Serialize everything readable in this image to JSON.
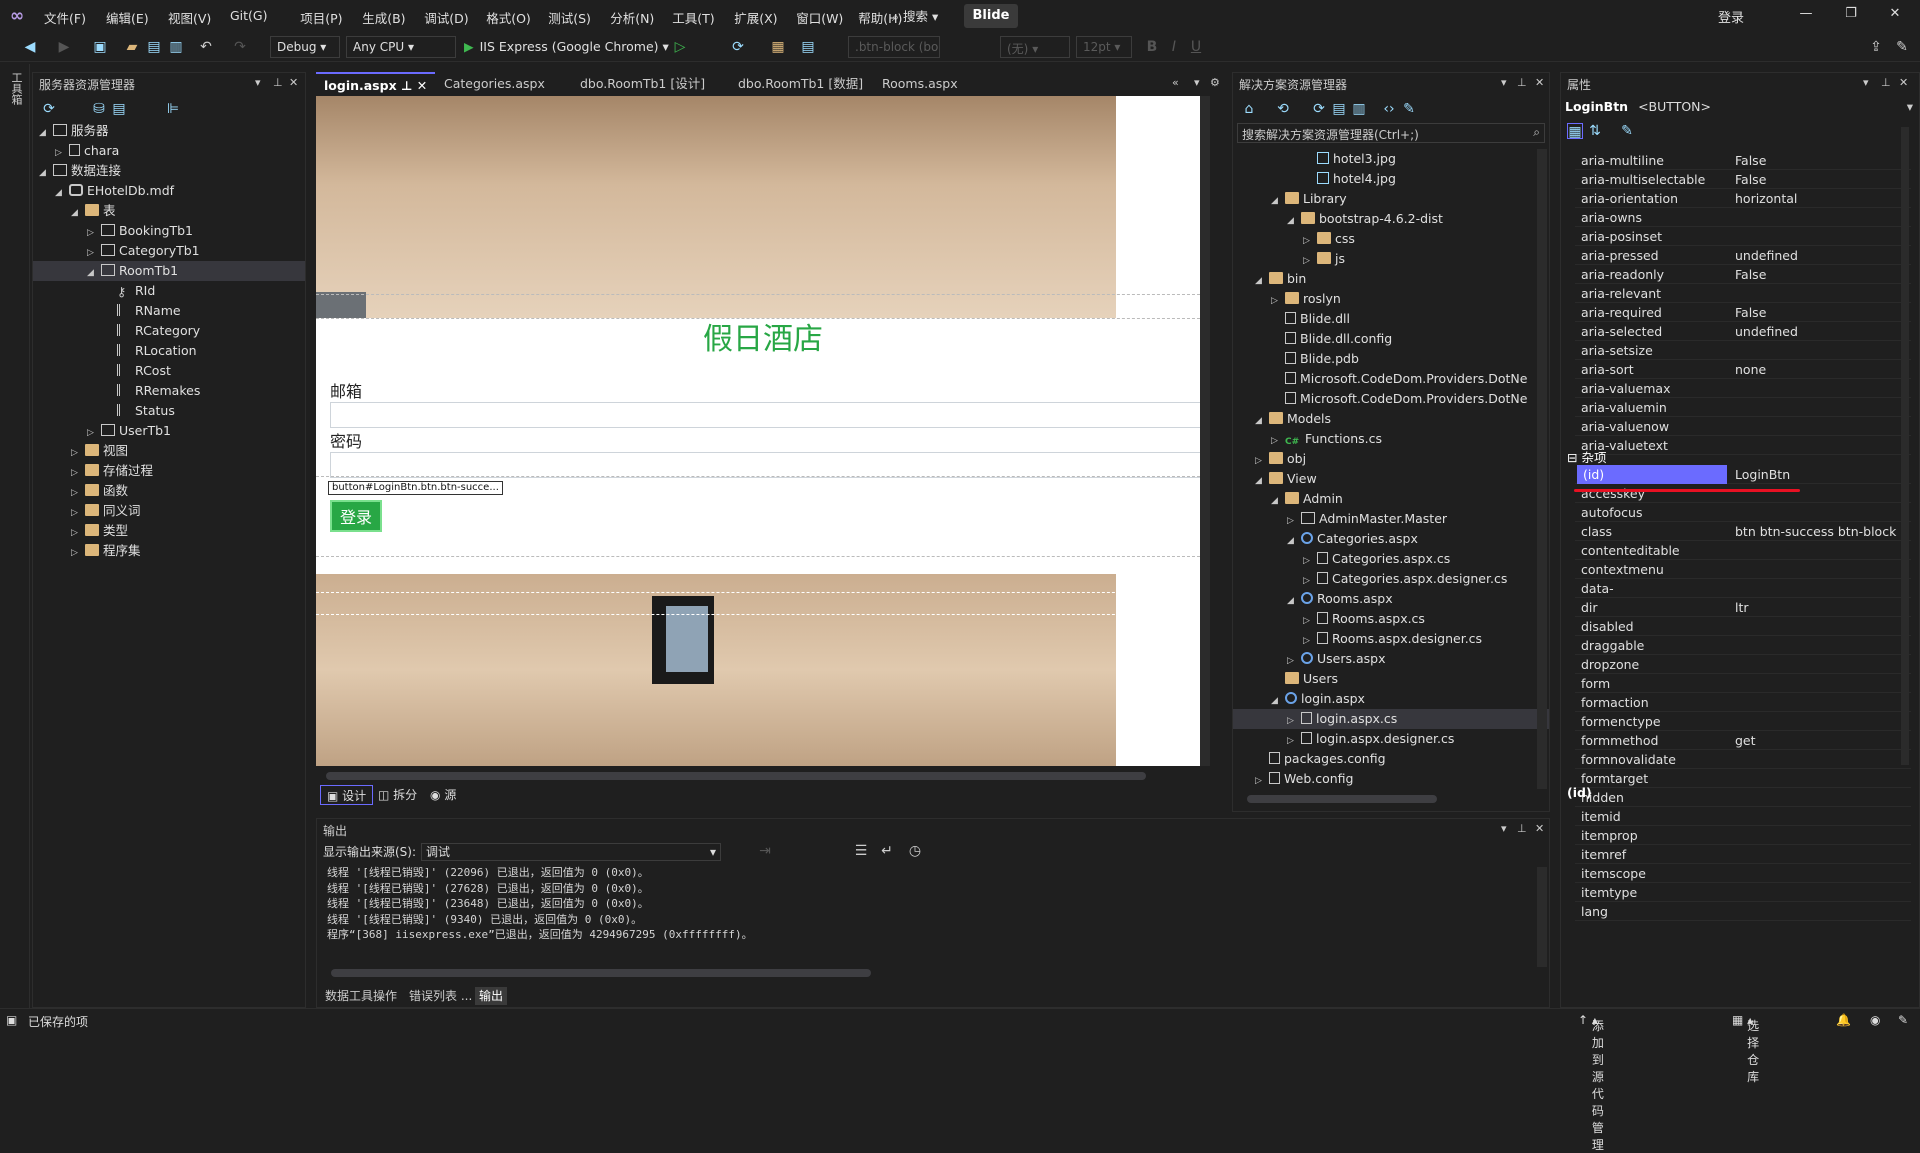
{
  "menu": [
    "文件(F)",
    "编辑(E)",
    "视图(V)",
    "Git(G)",
    "项目(P)",
    "生成(B)",
    "调试(D)",
    "格式(O)",
    "测试(S)",
    "分析(N)",
    "工具(T)",
    "扩展(X)",
    "窗口(W)",
    "帮助(H)"
  ],
  "search_label": "搜索",
  "project_name": "Blide",
  "login_label": "登录",
  "toolbar": {
    "config": "Debug",
    "platform": "Any CPU",
    "run_target": "IIS Express (Google Chrome)",
    "css_class_box": ".btn-block (bo",
    "style_box": "(无)",
    "font_size_box": "12pt"
  },
  "left_rail_label": "工具箱",
  "server_explorer": {
    "title": "服务器资源管理器",
    "rows": [
      {
        "label": "服务器",
        "icon": "server-icon",
        "indent": 0,
        "tw": "◢"
      },
      {
        "label": "chara",
        "icon": "computer-icon",
        "indent": 1,
        "tw": "▷"
      },
      {
        "label": "数据连接",
        "icon": "data-connection-icon",
        "indent": 0,
        "tw": "◢"
      },
      {
        "label": "EHotelDb.mdf",
        "icon": "database-icon",
        "indent": 1,
        "tw": "◢"
      },
      {
        "label": "表",
        "icon": "folder-icon",
        "indent": 2,
        "tw": "◢"
      },
      {
        "label": "BookingTb1",
        "icon": "table-icon",
        "indent": 3,
        "tw": "▷"
      },
      {
        "label": "CategoryTb1",
        "icon": "table-icon",
        "indent": 3,
        "tw": "▷"
      },
      {
        "label": "RoomTb1",
        "icon": "table-icon",
        "indent": 3,
        "tw": "◢",
        "selected": true
      },
      {
        "label": "RId",
        "icon": "key-icon",
        "indent": 4,
        "tw": ""
      },
      {
        "label": "RName",
        "icon": "column-icon",
        "indent": 4,
        "tw": ""
      },
      {
        "label": "RCategory",
        "icon": "column-icon",
        "indent": 4,
        "tw": ""
      },
      {
        "label": "RLocation",
        "icon": "column-icon",
        "indent": 4,
        "tw": ""
      },
      {
        "label": "RCost",
        "icon": "column-icon",
        "indent": 4,
        "tw": ""
      },
      {
        "label": "RRemakes",
        "icon": "column-icon",
        "indent": 4,
        "tw": ""
      },
      {
        "label": "Status",
        "icon": "column-icon",
        "indent": 4,
        "tw": ""
      },
      {
        "label": "UserTb1",
        "icon": "table-icon",
        "indent": 3,
        "tw": "▷"
      },
      {
        "label": "视图",
        "icon": "folder-icon",
        "indent": 2,
        "tw": "▷"
      },
      {
        "label": "存储过程",
        "icon": "folder-icon",
        "indent": 2,
        "tw": "▷"
      },
      {
        "label": "函数",
        "icon": "folder-icon",
        "indent": 2,
        "tw": "▷"
      },
      {
        "label": "同义词",
        "icon": "folder-icon",
        "indent": 2,
        "tw": "▷"
      },
      {
        "label": "类型",
        "icon": "folder-icon",
        "indent": 2,
        "tw": "▷"
      },
      {
        "label": "程序集",
        "icon": "folder-icon",
        "indent": 2,
        "tw": "▷"
      }
    ]
  },
  "doc_tabs": [
    "login.aspx",
    "Categories.aspx",
    "dbo.RoomTb1 [设计]",
    "dbo.RoomTb1 [数据]",
    "Rooms.aspx"
  ],
  "designer": {
    "hotel_title": "假日酒店",
    "email_label": "邮箱",
    "password_label": "密码",
    "login_button": "登录",
    "tag_tip": "button#LoginBtn.btn.btn-succe..."
  },
  "view_buttons": [
    "设计",
    "拆分",
    "源"
  ],
  "solution_explorer": {
    "title": "解决方案资源管理器",
    "search_placeholder": "搜索解决方案资源管理器(Ctrl+;)",
    "rows": [
      {
        "label": "hotel3.jpg",
        "icon": "image-icon",
        "indent": 4,
        "tw": ""
      },
      {
        "label": "hotel4.jpg",
        "icon": "image-icon",
        "indent": 4,
        "tw": ""
      },
      {
        "label": "Library",
        "icon": "folder-icon",
        "indent": 2,
        "tw": "◢"
      },
      {
        "label": "bootstrap-4.6.2-dist",
        "icon": "folder-icon",
        "indent": 3,
        "tw": "◢"
      },
      {
        "label": "css",
        "icon": "folder-icon",
        "indent": 4,
        "tw": "▷"
      },
      {
        "label": "js",
        "icon": "folder-icon",
        "indent": 4,
        "tw": "▷"
      },
      {
        "label": "bin",
        "icon": "folder-icon",
        "indent": 1,
        "tw": "◢"
      },
      {
        "label": "roslyn",
        "icon": "folder-outline-icon",
        "indent": 2,
        "tw": "▷"
      },
      {
        "label": "Blide.dll",
        "icon": "file-icon",
        "indent": 2,
        "tw": ""
      },
      {
        "label": "Blide.dll.config",
        "icon": "file-icon",
        "indent": 2,
        "tw": ""
      },
      {
        "label": "Blide.pdb",
        "icon": "file-icon",
        "indent": 2,
        "tw": ""
      },
      {
        "label": "Microsoft.CodeDom.Providers.DotNe",
        "icon": "file-icon",
        "indent": 2,
        "tw": ""
      },
      {
        "label": "Microsoft.CodeDom.Providers.DotNe",
        "icon": "file-icon",
        "indent": 2,
        "tw": ""
      },
      {
        "label": "Models",
        "icon": "folder-icon",
        "indent": 1,
        "tw": "◢"
      },
      {
        "label": "Functions.cs",
        "icon": "csharp-file-icon",
        "indent": 2,
        "tw": "▷"
      },
      {
        "label": "obj",
        "icon": "folder-outline-icon",
        "indent": 1,
        "tw": "▷"
      },
      {
        "label": "View",
        "icon": "folder-icon",
        "indent": 1,
        "tw": "◢"
      },
      {
        "label": "Admin",
        "icon": "folder-icon",
        "indent": 2,
        "tw": "◢"
      },
      {
        "label": "AdminMaster.Master",
        "icon": "master-page-icon",
        "indent": 3,
        "tw": "▷"
      },
      {
        "label": "Categories.aspx",
        "icon": "web-form-icon",
        "indent": 3,
        "tw": "◢"
      },
      {
        "label": "Categories.aspx.cs",
        "icon": "file-icon",
        "indent": 4,
        "tw": "▷"
      },
      {
        "label": "Categories.aspx.designer.cs",
        "icon": "file-icon",
        "indent": 4,
        "tw": "▷"
      },
      {
        "label": "Rooms.aspx",
        "icon": "web-form-icon",
        "indent": 3,
        "tw": "◢"
      },
      {
        "label": "Rooms.aspx.cs",
        "icon": "file-icon",
        "indent": 4,
        "tw": "▷"
      },
      {
        "label": "Rooms.aspx.designer.cs",
        "icon": "file-icon",
        "indent": 4,
        "tw": "▷"
      },
      {
        "label": "Users.aspx",
        "icon": "web-form-icon",
        "indent": 3,
        "tw": "▷"
      },
      {
        "label": "Users",
        "icon": "folder-icon",
        "indent": 2,
        "tw": ""
      },
      {
        "label": "login.aspx",
        "icon": "web-form-icon",
        "indent": 2,
        "tw": "◢"
      },
      {
        "label": "login.aspx.cs",
        "icon": "file-icon",
        "indent": 3,
        "tw": "▷",
        "selected": true
      },
      {
        "label": "login.aspx.designer.cs",
        "icon": "file-icon",
        "indent": 3,
        "tw": "▷"
      },
      {
        "label": "packages.config",
        "icon": "config-icon",
        "indent": 1,
        "tw": ""
      },
      {
        "label": "Web.config",
        "icon": "config-icon",
        "indent": 1,
        "tw": "▷"
      }
    ]
  },
  "properties": {
    "title": "属性",
    "object_name": "LoginBtn",
    "object_type": "<BUTTON>",
    "section": "杂项",
    "footer": "(id)",
    "rows": [
      {
        "k": "aria-multiline",
        "v": "False"
      },
      {
        "k": "aria-multiselectable",
        "v": "False"
      },
      {
        "k": "aria-orientation",
        "v": "horizontal"
      },
      {
        "k": "aria-owns",
        "v": ""
      },
      {
        "k": "aria-posinset",
        "v": ""
      },
      {
        "k": "aria-pressed",
        "v": "undefined"
      },
      {
        "k": "aria-readonly",
        "v": "False"
      },
      {
        "k": "aria-relevant",
        "v": ""
      },
      {
        "k": "aria-required",
        "v": "False"
      },
      {
        "k": "aria-selected",
        "v": "undefined"
      },
      {
        "k": "aria-setsize",
        "v": ""
      },
      {
        "k": "aria-sort",
        "v": "none"
      },
      {
        "k": "aria-valuemax",
        "v": ""
      },
      {
        "k": "aria-valuemin",
        "v": ""
      },
      {
        "k": "aria-valuenow",
        "v": ""
      },
      {
        "k": "aria-valuetext",
        "v": ""
      }
    ],
    "misc_rows": [
      {
        "k": "(id)",
        "v": "LoginBtn",
        "selected": true
      },
      {
        "k": "accesskey",
        "v": ""
      },
      {
        "k": "autofocus",
        "v": ""
      },
      {
        "k": "class",
        "v": "btn btn-success btn-block"
      },
      {
        "k": "contenteditable",
        "v": ""
      },
      {
        "k": "contextmenu",
        "v": ""
      },
      {
        "k": "data-",
        "v": ""
      },
      {
        "k": "dir",
        "v": "ltr"
      },
      {
        "k": "disabled",
        "v": ""
      },
      {
        "k": "draggable",
        "v": ""
      },
      {
        "k": "dropzone",
        "v": ""
      },
      {
        "k": "form",
        "v": ""
      },
      {
        "k": "formaction",
        "v": ""
      },
      {
        "k": "formenctype",
        "v": ""
      },
      {
        "k": "formmethod",
        "v": "get"
      },
      {
        "k": "formnovalidate",
        "v": ""
      },
      {
        "k": "formtarget",
        "v": ""
      },
      {
        "k": "hidden",
        "v": ""
      },
      {
        "k": "itemid",
        "v": ""
      },
      {
        "k": "itemprop",
        "v": ""
      },
      {
        "k": "itemref",
        "v": ""
      },
      {
        "k": "itemscope",
        "v": ""
      },
      {
        "k": "itemtype",
        "v": ""
      },
      {
        "k": "lang",
        "v": ""
      }
    ]
  },
  "output": {
    "title": "输出",
    "source_label": "显示输出来源(S):",
    "source_value": "调试",
    "lines": [
      "线程 '[线程已销毁]' (22096) 已退出，返回值为 0 (0x0)。",
      "线程 '[线程已销毁]' (27628) 已退出，返回值为 0 (0x0)。",
      "线程 '[线程已销毁]' (23648) 已退出，返回值为 0 (0x0)。",
      "线程 '[线程已销毁]' (9340) 已退出，返回值为 0 (0x0)。",
      "程序“[368] iisexpress.exe”已退出，返回值为 4294967295 (0xffffffff)。"
    ],
    "tabs": [
      "数据工具操作",
      "错误列表 ...",
      "输出"
    ]
  },
  "status": {
    "left": "已保存的项",
    "source_control": "添加到源代码管理",
    "repo": "选择仓库"
  },
  "colors": {
    "accent": "#6b6bff",
    "success": "#28a745",
    "underline": "#e81123"
  }
}
